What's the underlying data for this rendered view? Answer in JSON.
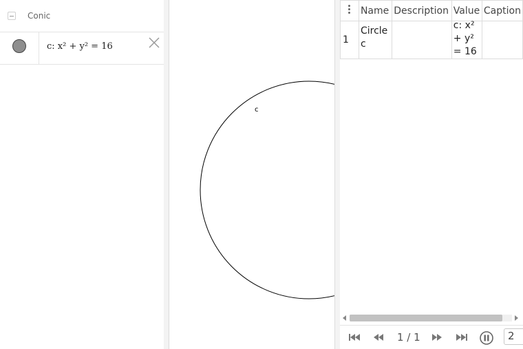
{
  "algebra": {
    "group_label": "Conic",
    "item": {
      "definition": "c: x² + y² = 16",
      "marble_color": "#8e8e8e"
    }
  },
  "graphics": {
    "object_label": "c",
    "stroke_color": "#000000"
  },
  "protocol": {
    "columns": [
      "Name",
      "Description",
      "Value",
      "Caption"
    ],
    "rows": [
      {
        "number": "1",
        "name_lines": [
          "Circle",
          "c"
        ],
        "description": "",
        "value_lines": [
          "c: x²",
          "+ y²",
          "= 16"
        ],
        "caption": ""
      }
    ],
    "navigation": {
      "step_counter": "1 / 1",
      "speed_value": "2"
    }
  }
}
